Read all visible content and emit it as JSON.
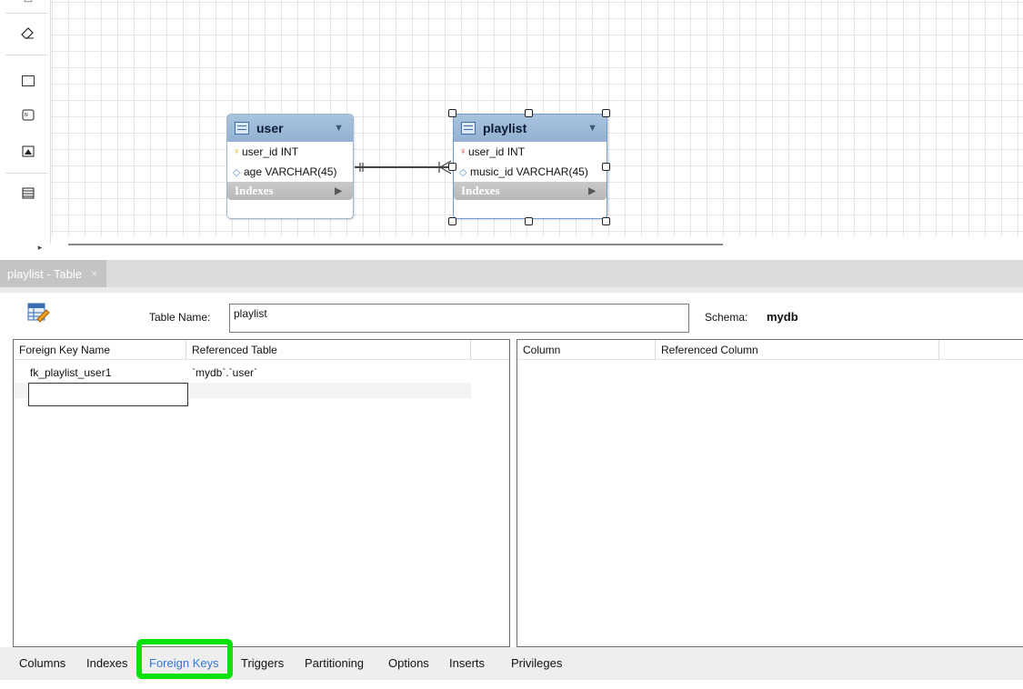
{
  "diagram": {
    "tables": [
      {
        "name": "user",
        "columns": [
          {
            "label": "user_id INT",
            "kind": "primary-key"
          },
          {
            "label": "age VARCHAR(45)",
            "kind": "column"
          }
        ],
        "indexes_label": "Indexes"
      },
      {
        "name": "playlist",
        "columns": [
          {
            "label": "user_id INT",
            "kind": "foreign-primary-key"
          },
          {
            "label": "music_id VARCHAR(45)",
            "kind": "column"
          }
        ],
        "indexes_label": "Indexes"
      }
    ]
  },
  "editor_tab": {
    "label": "playlist - Table",
    "close": "×"
  },
  "editor": {
    "table_name_label": "Table Name:",
    "table_name_value": "playlist",
    "schema_label": "Schema:",
    "schema_value": "mydb"
  },
  "foreign_keys": {
    "headers": [
      "Foreign Key Name",
      "Referenced Table"
    ],
    "rows": [
      {
        "name": "fk_playlist_user1",
        "referenced_table": "`mydb`.`user`"
      }
    ]
  },
  "columns_grid": {
    "headers": [
      "Column",
      "Referenced Column"
    ]
  },
  "subtabs": [
    "Columns",
    "Indexes",
    "Foreign Keys",
    "Triggers",
    "Partitioning",
    "Options",
    "Inserts",
    "Privileges"
  ],
  "active_subtab": "Foreign Keys",
  "colors": {
    "highlight": "#0be10b",
    "active_tab_text": "#3477d6",
    "table_header": "#93b1d2"
  }
}
